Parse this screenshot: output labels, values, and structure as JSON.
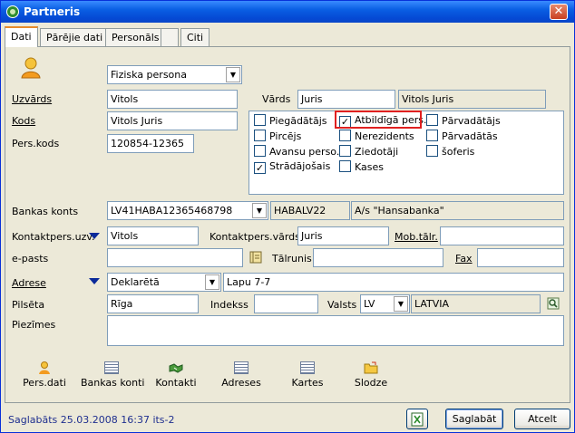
{
  "window": {
    "title": "Partneris"
  },
  "tabs": [
    "Dati",
    "Pārējie dati",
    "Personāls",
    "",
    "Citi"
  ],
  "form": {
    "person_type": "Fiziska persona",
    "uzvards_label": "Uzvārds",
    "uzvards_value": "Vitols",
    "vards_label": "Vārds",
    "vards_value": "Juris",
    "full_name": "Vitols Juris",
    "kods_label": "Kods",
    "kods_value": "Vitols Juris",
    "perskods_label": "Pers.kods",
    "perskods_value": "120854-12365",
    "bankas_konts_label": "Bankas konts",
    "bankas_konts_value": "LV41HABA12365468798",
    "bank_code": "HABALV22",
    "bank_name": "A/s \"Hansabanka\"",
    "kontaktpers_uzv_label": "Kontaktpers.uzv.",
    "kontaktpers_uzv_value": "Vitols",
    "kontaktpers_vards_label": "Kontaktpers.vārds",
    "kontaktpers_vards_value": "Juris",
    "mob_label": "Mob.tālr.",
    "mob_value": "",
    "epasts_label": "e-pasts",
    "epasts_value": "",
    "talrunis_label": "Tālrunis",
    "talrunis_value": "",
    "fax_label": "Fax",
    "fax_value": "",
    "adrese_label": "Adrese",
    "adrese_type": "Deklarētā",
    "adrese_value": "Lapu 7-7",
    "pilseta_label": "Pilsēta",
    "pilseta_value": "Rīga",
    "indekss_label": "Indekss",
    "indekss_value": "",
    "valsts_label": "Valsts",
    "valsts_code": "LV",
    "valsts_name": "LATVIA",
    "piezimes_label": "Piezīmes",
    "piezimes_value": ""
  },
  "checkboxes": [
    {
      "label": "Piegādātājs",
      "checked": false
    },
    {
      "label": "Atbildīgā pers...",
      "checked": true
    },
    {
      "label": "Pārvadātājs",
      "checked": false
    },
    {
      "label": "Pircējs",
      "checked": false
    },
    {
      "label": "Nerezidents",
      "checked": false
    },
    {
      "label": "Pārvadātās",
      "checked": false
    },
    {
      "label": "Avansu perso...",
      "checked": false
    },
    {
      "label": "Ziedotāji",
      "checked": false
    },
    {
      "label": "šoferis",
      "checked": false
    },
    {
      "label": "Strādājošais",
      "checked": true
    },
    {
      "label": "Kases",
      "checked": false
    }
  ],
  "toolbar": [
    "Pers.dati",
    "Bankas konti",
    "Kontakti",
    "Adreses",
    "Kartes",
    "Slodze"
  ],
  "footer": {
    "status": "Saglabāts 25.03.2008 16:37 its-2",
    "save": "Saglabāt",
    "cancel": "Atcelt"
  },
  "colors": {
    "title_bar": "#0A5FE3",
    "highlight": "#E02020",
    "status_text": "#1F2F8F"
  }
}
